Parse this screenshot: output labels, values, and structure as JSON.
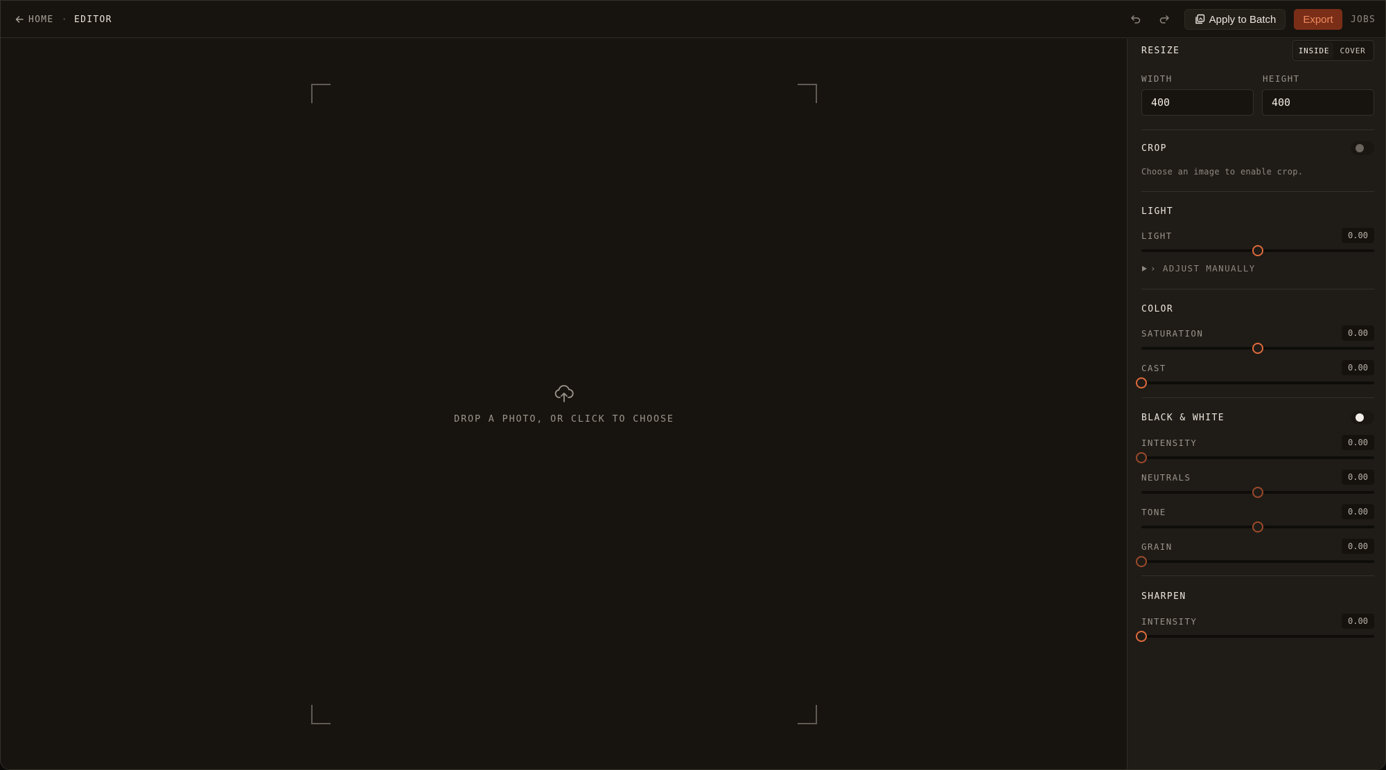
{
  "nav": {
    "back_label": "HOME",
    "separator": "·",
    "current": "EDITOR"
  },
  "toolbar": {
    "undo_icon": "undo-icon",
    "redo_icon": "redo-icon",
    "batch_label": "Apply to Batch",
    "export_label": "Export",
    "jobs_label": "JOBS"
  },
  "dropzone": {
    "text": "DROP A PHOTO, OR CLICK TO CHOOSE",
    "icon": "cloud-upload-icon"
  },
  "colors": {
    "accent": "#e06a3c",
    "export_bg": "#7a2e17",
    "panel_bg": "#1f1c17",
    "canvas_bg": "#17140f"
  },
  "panel": {
    "resize": {
      "title": "RESIZE",
      "modes": [
        "INSIDE",
        "COVER"
      ],
      "active_mode": "INSIDE",
      "width_label": "WIDTH",
      "height_label": "HEIGHT",
      "width_value": "400",
      "height_value": "400"
    },
    "crop": {
      "title": "CROP",
      "enabled": false,
      "hint": "Choose an image to enable crop."
    },
    "light": {
      "title": "LIGHT",
      "sliders": [
        {
          "label": "LIGHT",
          "value": "0.00",
          "position": 0.5
        }
      ],
      "disclosure": "› ADJUST MANUALLY"
    },
    "color": {
      "title": "COLOR",
      "sliders": [
        {
          "label": "SATURATION",
          "value": "0.00",
          "position": 0.5
        },
        {
          "label": "CAST",
          "value": "0.00",
          "position": 0.0
        }
      ]
    },
    "bw": {
      "title": "BLACK & WHITE",
      "enabled": true,
      "sliders": [
        {
          "label": "INTENSITY",
          "value": "0.00",
          "position": 0.0
        },
        {
          "label": "NEUTRALS",
          "value": "0.00",
          "position": 0.5
        },
        {
          "label": "TONE",
          "value": "0.00",
          "position": 0.5
        },
        {
          "label": "GRAIN",
          "value": "0.00",
          "position": 0.0
        }
      ]
    },
    "sharpen": {
      "title": "SHARPEN",
      "sliders": [
        {
          "label": "INTENSITY",
          "value": "0.00",
          "position": 0.0
        }
      ]
    }
  }
}
